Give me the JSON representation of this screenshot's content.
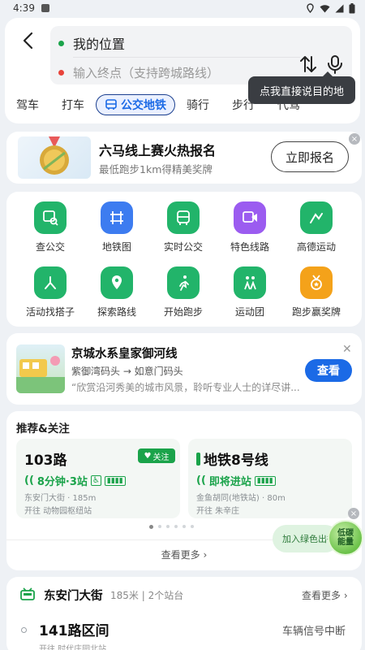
{
  "status_bar": {
    "time": "4:39",
    "battery": "100%"
  },
  "route": {
    "start_label": "我的位置",
    "end_placeholder": "输入终点（支持跨城路线）",
    "voice_tip": "点我直接说目的地"
  },
  "tabs": [
    {
      "label": "驾车"
    },
    {
      "label": "打车"
    },
    {
      "label": "公交地铁"
    },
    {
      "label": "骑行"
    },
    {
      "label": "步行"
    },
    {
      "label": "代驾"
    }
  ],
  "promo": {
    "title": "六马线上赛火热报名",
    "subtitle": "最低跑步1km得精美奖牌",
    "button": "立即报名"
  },
  "grid": [
    {
      "label": "查公交",
      "icon": "bus-search-icon",
      "color": "#22b46a"
    },
    {
      "label": "地铁图",
      "icon": "subway-map-icon",
      "color": "#3d7cf0"
    },
    {
      "label": "实时公交",
      "icon": "realtime-bus-icon",
      "color": "#22b46a"
    },
    {
      "label": "特色线路",
      "icon": "special-route-icon",
      "color": "#9b5cf0"
    },
    {
      "label": "高德运动",
      "icon": "sport-icon",
      "color": "#22b46a"
    },
    {
      "label": "活动找搭子",
      "icon": "buddy-icon",
      "color": "#22b46a"
    },
    {
      "label": "探索路线",
      "icon": "explore-route-icon",
      "color": "#22b46a"
    },
    {
      "label": "开始跑步",
      "icon": "run-icon",
      "color": "#22b46a"
    },
    {
      "label": "运动团",
      "icon": "group-run-icon",
      "color": "#22b46a"
    },
    {
      "label": "跑步赢奖牌",
      "icon": "medal-icon",
      "color": "#f4a21a"
    }
  ],
  "ad": {
    "title": "京城水系皇家御河线",
    "route": "紫御湾码头 → 如意门码头",
    "desc": "“欣赏沿河秀美的城市风景，聆听专业人士的详尽讲...",
    "button": "查看"
  },
  "recommend": {
    "title": "推荐&关注",
    "lines": [
      {
        "name": "103路",
        "status": "8分钟·3站",
        "stop": "东安门大街 · 185m",
        "direction": "开往 动物园枢纽站",
        "badge": "关注"
      },
      {
        "name": "地铁8号线",
        "status": "即将进站",
        "stop": "金鱼胡同(地铁站) · 80m",
        "direction": "开往 朱辛庄"
      }
    ],
    "see_more": "查看更多"
  },
  "green": {
    "pill": "加入绿色出行",
    "ball_line1": "低碳",
    "ball_line2": "能量"
  },
  "station": {
    "name": "东安门大街",
    "meta": "185米 | 2个站台",
    "more": "查看更多",
    "bus_line": "141路区间",
    "signal": "车辆信号中断",
    "direction": "开往 时代庄园北站"
  }
}
